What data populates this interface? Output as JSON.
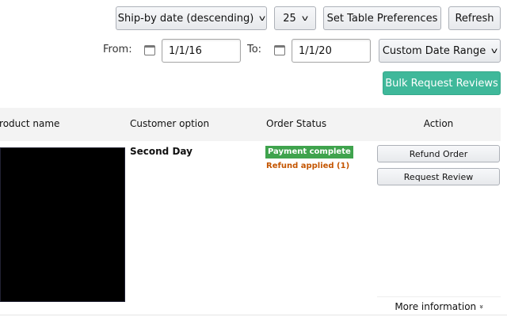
{
  "toolbar": {
    "sort_select": "Ship-by date (descending)",
    "page_size_select": "25",
    "set_table_preferences": "Set Table Preferences",
    "refresh": "Refresh"
  },
  "date_filter": {
    "from_label": "From:",
    "from_value": "1/1/16",
    "to_label": "To:",
    "to_value": "1/1/20",
    "range_select": "Custom Date Range"
  },
  "bulk_request_reviews": "Bulk Request Reviews",
  "table": {
    "headers": [
      "Product name",
      "Customer option",
      "Order Status",
      "Action"
    ],
    "rows": [
      {
        "customer_option": "Second Day",
        "status_badge": "Payment complete",
        "status_note": "Refund applied (1)",
        "actions": [
          "Refund Order",
          "Request Review"
        ],
        "more_info": "More information"
      }
    ]
  },
  "colors": {
    "accent": "#3fb89a",
    "badge": "#3fa34d",
    "refund": "#c45500"
  }
}
